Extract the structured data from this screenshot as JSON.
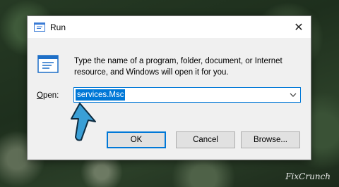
{
  "window": {
    "title": "Run",
    "close_glyph": "✕"
  },
  "body": {
    "description": "Type the name of a program, folder, document, or Internet resource, and Windows will open it for you."
  },
  "open_field": {
    "label_accel": "O",
    "label_rest": "pen:",
    "value": "services.Msc"
  },
  "buttons": {
    "ok": "OK",
    "cancel": "Cancel",
    "browse": "Browse..."
  },
  "watermark": {
    "brand": "FixCrunch"
  },
  "colors": {
    "accent": "#0078d7",
    "annotation_arrow": "#3a9fd6"
  },
  "icons": {
    "run_small": "run-app-icon",
    "run_large": "run-app-icon",
    "dropdown": "chevron-down-icon",
    "annotation": "pointer-arrow-icon"
  }
}
